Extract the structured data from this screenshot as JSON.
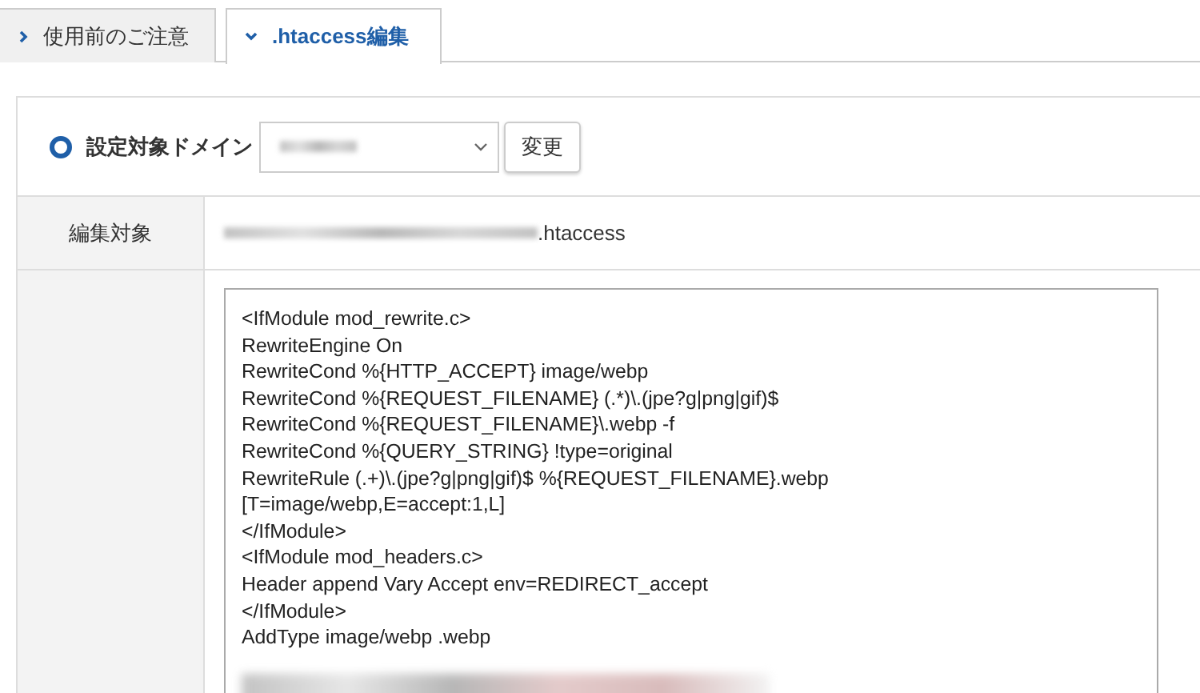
{
  "tabs": [
    {
      "label": "使用前のご注意",
      "selected": false
    },
    {
      "label": ".htaccess編集",
      "selected": true
    }
  ],
  "domain_row": {
    "radio_checked": true,
    "label": "設定対象ドメイン",
    "change_button": "変更"
  },
  "edit_target": {
    "label": "編集対象",
    "file_suffix": ".htaccess"
  },
  "editor": {
    "lines": [
      "<IfModule mod_rewrite.c>",
      "RewriteEngine On",
      "RewriteCond %{HTTP_ACCEPT} image/webp",
      "RewriteCond %{REQUEST_FILENAME} (.*)\\.(jpe?g|png|gif)$",
      "RewriteCond %{REQUEST_FILENAME}\\.webp -f",
      "RewriteCond %{QUERY_STRING} !type=original",
      "RewriteRule (.+)\\.(jpe?g|png|gif)$ %{REQUEST_FILENAME}.webp",
      "[T=image/webp,E=accept:1,L]",
      "</IfModule>",
      "<IfModule mod_headers.c>",
      "Header append Vary Accept env=REDIRECT_accept",
      "</IfModule>",
      "AddType image/webp .webp"
    ]
  }
}
